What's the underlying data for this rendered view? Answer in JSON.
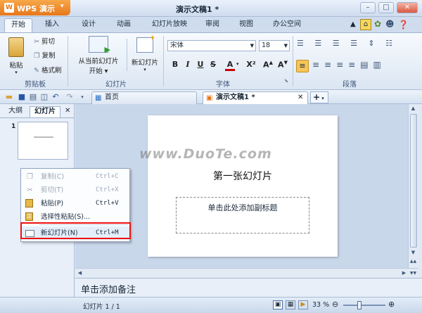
{
  "app": {
    "name": "WPS 演示",
    "doc_title": "演示文稿1 *"
  },
  "menu_tabs": [
    "开始",
    "插入",
    "设计",
    "动画",
    "幻灯片放映",
    "审阅",
    "视图",
    "办公空间"
  ],
  "ribbon": {
    "clipboard": {
      "paste": "粘贴",
      "cut": "剪切",
      "copy": "复制",
      "format_painter": "格式刷",
      "group": "剪贴板"
    },
    "slides": {
      "from_current_1": "从当前幻灯片",
      "from_current_2": "开始",
      "new_slide": "新幻灯片",
      "group": "幻灯片"
    },
    "font": {
      "name": "宋体",
      "size": "18",
      "group": "字体"
    },
    "paragraph": {
      "group": "段落"
    }
  },
  "doc_tabs": {
    "home": "首页",
    "doc": "演示文稿1 *"
  },
  "left_panel": {
    "tab_outline": "大纲",
    "tab_slides": "幻灯片",
    "slide_number": "1"
  },
  "context_menu": [
    {
      "label": "复制(C)",
      "shortcut": "Ctrl+C",
      "icon": "copy-icon",
      "enabled": false
    },
    {
      "label": "剪切(T)",
      "shortcut": "Ctrl+X",
      "icon": "scissors-icon",
      "enabled": false
    },
    {
      "label": "粘贴(P)",
      "shortcut": "Ctrl+V",
      "icon": "paste-icon",
      "enabled": true
    },
    {
      "label": "选择性粘贴(S)...",
      "shortcut": "",
      "icon": "paste-special-icon",
      "enabled": true
    },
    {
      "label": "新幻灯片(N)",
      "shortcut": "Ctrl+M",
      "icon": "new-slide-icon",
      "enabled": true
    }
  ],
  "slide": {
    "title": "第一张幻灯片",
    "subtitle_placeholder": "单击此处添加副标题"
  },
  "watermark": "www.DuoTe.com",
  "notes_placeholder": "单击添加备注",
  "status": {
    "slide_info": "幻灯片 1 / 1",
    "zoom": "33 %"
  },
  "colors": {
    "accent_orange": "#e6771a",
    "highlight_red": "#e11111",
    "ribbon_blue": "#dbe6f3"
  }
}
